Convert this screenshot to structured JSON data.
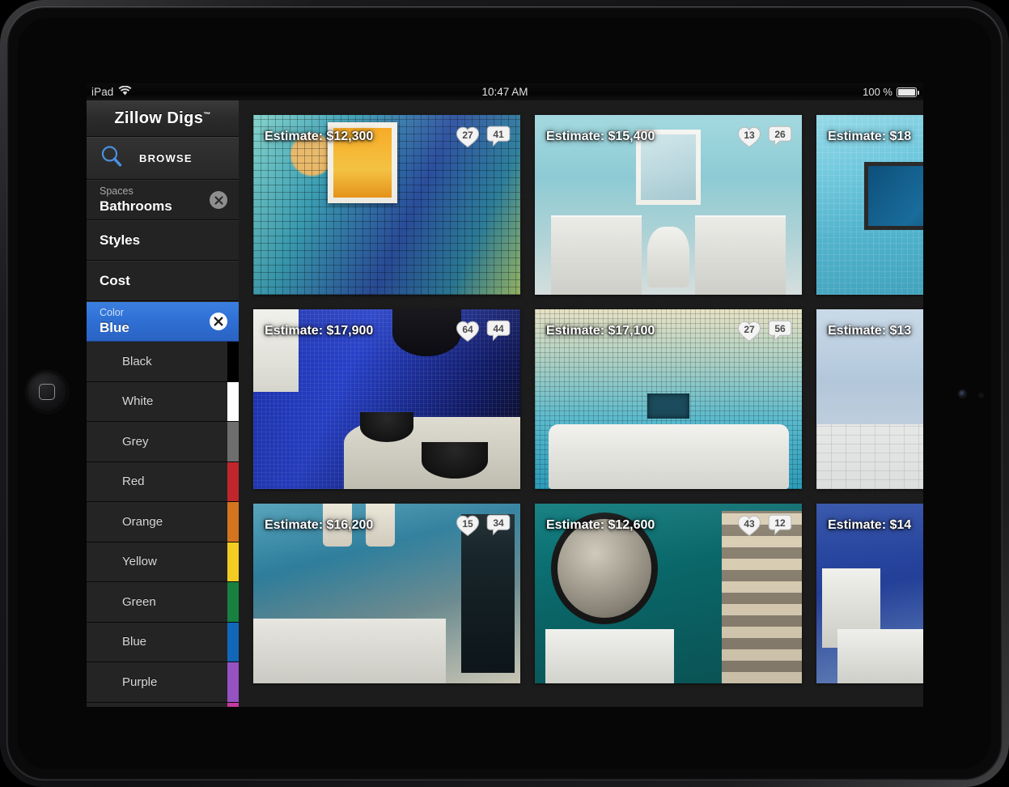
{
  "status_bar": {
    "device_label": "iPad",
    "wifi_icon": "wifi-icon",
    "time": "10:47 AM",
    "battery_percent": "100 %",
    "battery_icon": "battery-icon"
  },
  "sidebar": {
    "brand": "Zillow Digs",
    "brand_tm": "™",
    "browse": {
      "label": "BROWSE",
      "icon": "search-icon"
    },
    "filters": [
      {
        "sub": "Spaces",
        "value": "Bathrooms",
        "has_clear": true,
        "active": false
      },
      {
        "title": "Styles",
        "has_clear": false,
        "active": false
      },
      {
        "title": "Cost",
        "has_clear": false,
        "active": false
      },
      {
        "sub": "Color",
        "value": "Blue",
        "has_clear": true,
        "active": true
      }
    ],
    "clear_icon": "close-x-icon",
    "colors": [
      {
        "label": "Black",
        "swatch": "#000000"
      },
      {
        "label": "White",
        "swatch": "#ffffff"
      },
      {
        "label": "Grey",
        "swatch": "#6e6e6e"
      },
      {
        "label": "Red",
        "swatch": "#c1262c"
      },
      {
        "label": "Orange",
        "swatch": "#d4741f"
      },
      {
        "label": "Yellow",
        "swatch": "#f3cc23"
      },
      {
        "label": "Green",
        "swatch": "#188140"
      },
      {
        "label": "Blue",
        "swatch": "#1267b8"
      },
      {
        "label": "Purple",
        "swatch": "#9552c0"
      },
      {
        "label": "",
        "swatch": "#c4399f"
      }
    ]
  },
  "grid": {
    "estimate_prefix": "Estimate: ",
    "like_icon": "heart-icon",
    "comment_icon": "speech-bubble-icon",
    "cards": [
      {
        "estimate": "Estimate: $12,300",
        "likes": "27",
        "comments": "41",
        "art": "mosaic-a",
        "clipped": false
      },
      {
        "estimate": "Estimate: $15,400",
        "likes": "13",
        "comments": "26",
        "art": "photo-b",
        "clipped": false
      },
      {
        "estimate": "Estimate: $18",
        "likes": "",
        "comments": "",
        "art": "photo-c",
        "clipped": true
      },
      {
        "estimate": "Estimate: $17,900",
        "likes": "64",
        "comments": "44",
        "art": "photo-d",
        "clipped": false
      },
      {
        "estimate": "Estimate: $17,100",
        "likes": "27",
        "comments": "56",
        "art": "photo-e",
        "clipped": false
      },
      {
        "estimate": "Estimate: $13",
        "likes": "",
        "comments": "",
        "art": "photo-f",
        "clipped": true
      },
      {
        "estimate": "Estimate: $16,200",
        "likes": "15",
        "comments": "34",
        "art": "photo-g",
        "clipped": false
      },
      {
        "estimate": "Estimate: $12,600",
        "likes": "43",
        "comments": "12",
        "art": "photo-h",
        "clipped": false
      },
      {
        "estimate": "Estimate: $14",
        "likes": "",
        "comments": "",
        "art": "photo-i",
        "clipped": true
      }
    ]
  },
  "theme": {
    "accent_blue": "#2f6fd4",
    "sidebar_bg": "#232323",
    "app_bg": "#1a1a1a",
    "browse_icon_blue": "#4a90e2"
  }
}
